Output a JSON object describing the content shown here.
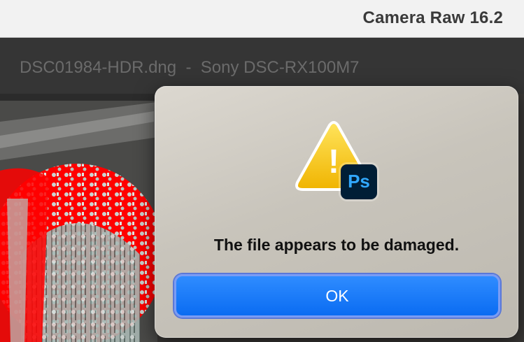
{
  "titlebar": {
    "app_title": "Camera Raw 16.2"
  },
  "document": {
    "title": "DSC01984-HDR.dng  -  Sony DSC-RX100M7"
  },
  "dialog": {
    "message": "The file appears to be damaged.",
    "ok_label": "OK",
    "badge_text": "Ps",
    "warning_glyph": "!"
  },
  "colors": {
    "ok_button": "#0a6cf2",
    "warning_yellow": "#f2c200",
    "ps_badge_bg": "#001e36",
    "ps_badge_text": "#31a8ff",
    "highlight_clip": "#ff0000"
  },
  "icons": {
    "warning": "warning-triangle-icon",
    "app_badge": "photoshop-badge-icon"
  }
}
